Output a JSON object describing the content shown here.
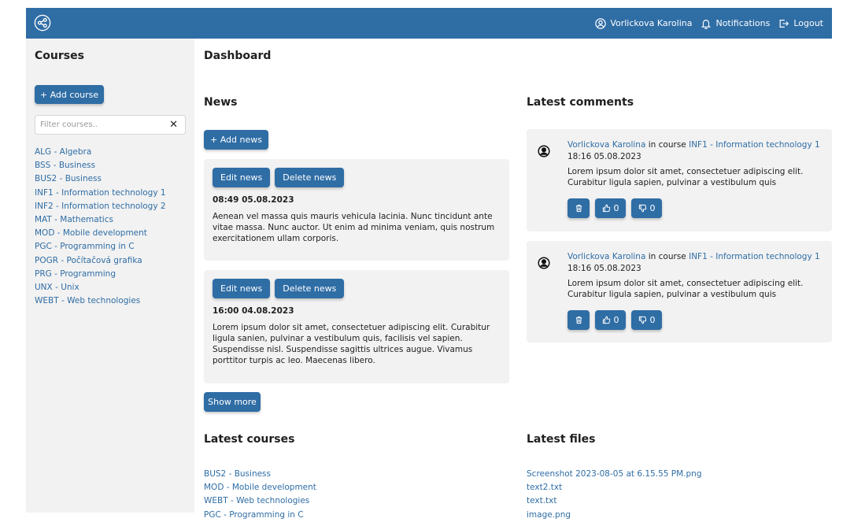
{
  "header": {
    "logo_icon": "share-icon",
    "user_name": "Vorlickova Karolina",
    "notifications_label": "Notifications",
    "logout_label": "Logout",
    "bar_color": "#2f6da5"
  },
  "sidebar": {
    "title": "Courses",
    "add_course_label": "+ Add course",
    "filter_placeholder": "Filter courses..",
    "filter_clear": "✕",
    "courses": [
      "ALG - Algebra",
      "BSS - Business",
      "BUS2 - Business",
      "INF1 - Information technology 1",
      "INF2 - Information technology 2",
      "MAT - Mathematics",
      "MOD - Mobile development",
      "PGC - Programming in C",
      "POGR - Počítačová grafika",
      "PRG - Programming",
      "UNX - Unix",
      "WEBT - Web technologies"
    ]
  },
  "main": {
    "title": "Dashboard",
    "news": {
      "title": "News",
      "add_label": "+ Add news",
      "edit_label": "Edit news",
      "delete_label": "Delete news",
      "items": [
        {
          "date": "08:49 05.08.2023",
          "text": "Aenean vel massa quis mauris vehicula lacinia. Nunc tincidunt ante vitae massa. Nunc auctor. Ut enim ad minima veniam, quis nostrum exercitationem ullam corporis."
        },
        {
          "date": "16:00 04.08.2023",
          "text": "Lorem ipsum dolor sit amet, consectetuer adipiscing elit. Curabitur ligula sanien, pulvinar a vestibulum quis, facilisis vel sapien. Suspendisse nisl. Suspendisse sagittis ultrices augue. Vivamus porttitor turpis ac leo. Maecenas libero."
        }
      ],
      "show_more_label": "Show more"
    },
    "comments": {
      "title": "Latest comments",
      "items": [
        {
          "author": "Vorlickova Karolina",
          "in_course": "in course",
          "course": "INF1 - Information technology 1",
          "date": "18:16 05.08.2023",
          "text": "Lorem ipsum dolor sit amet, consectetuer adipiscing elit. Curabitur ligula sapien, pulvinar a vestibulum quis",
          "likes": "0",
          "dislikes": "0"
        },
        {
          "author": "Vorlickova Karolina",
          "in_course": "in course",
          "course": "INF1 - Information technology 1",
          "date": "18:16 05.08.2023",
          "text": "Lorem ipsum dolor sit amet, consectetuer adipiscing elit. Curabitur ligula sapien, pulvinar a vestibulum quis",
          "likes": "0",
          "dislikes": "0"
        }
      ]
    },
    "latest_courses": {
      "title": "Latest courses",
      "items": [
        "BUS2 - Business",
        "MOD - Mobile development",
        "WEBT - Web technologies",
        "PGC - Programming in C"
      ]
    },
    "latest_files": {
      "title": "Latest files",
      "items": [
        "Screenshot 2023-08-05 at 6.15.55 PM.png",
        "text2.txt",
        "text.txt",
        "image.png"
      ]
    }
  }
}
